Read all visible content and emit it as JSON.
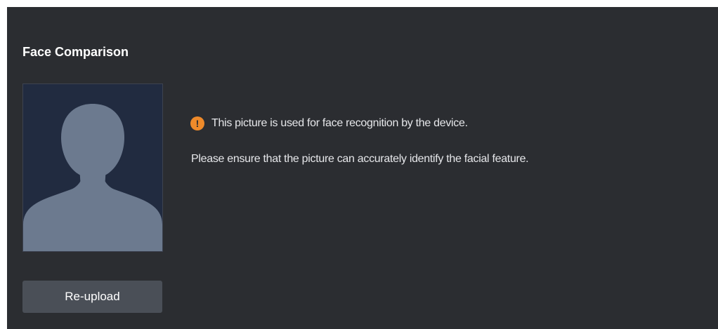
{
  "panel": {
    "title": "Face Comparison"
  },
  "photo": {
    "placeholder_icon": "avatar-silhouette-icon"
  },
  "notice": {
    "icon": "warning-icon",
    "icon_glyph": "!",
    "icon_color": "#ee8a2a",
    "line1": "This picture is used for face recognition by the device.",
    "line2": "Please ensure that the picture can accurately identify the facial feature."
  },
  "actions": {
    "reupload_label": "Re-upload"
  },
  "colors": {
    "panel_bg": "#2b2d31",
    "photo_bg": "#212b40",
    "silhouette": "#6c7a8f",
    "button_bg": "#4a4f57"
  }
}
